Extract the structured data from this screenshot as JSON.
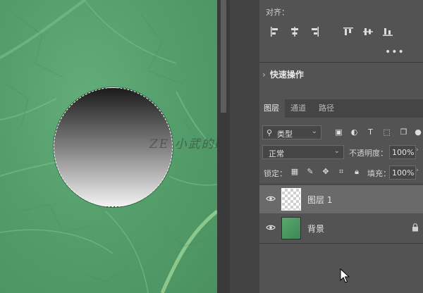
{
  "canvas": {
    "watermark": "ZE 小武的PS笔记"
  },
  "align_panel": {
    "title": "对齐：",
    "icons": [
      "align-left-edges-icon",
      "align-horizontal-centers-icon",
      "align-right-edges-icon",
      "align-top-edges-icon",
      "align-vertical-centers-icon",
      "align-bottom-edges-icon"
    ],
    "more": "•••"
  },
  "quick_actions": {
    "label": "快速操作"
  },
  "layers_panel": {
    "tabs": [
      "图层",
      "通道",
      "路径"
    ],
    "active_tab": "图层",
    "filter": {
      "label": "类型"
    },
    "blend_mode": "正常",
    "opacity_label": "不透明度：",
    "opacity_value": "100%",
    "lock_label": "锁定：",
    "fill_label": "填充：",
    "fill_value": "100%",
    "layers": [
      {
        "name": "图层 1",
        "selected": true,
        "visible": true,
        "locked": false
      },
      {
        "name": "背景",
        "selected": false,
        "visible": true,
        "locked": true
      }
    ]
  },
  "colors": {
    "panel_bg": "#535353",
    "selected_layer_bg": "#6a6a6a",
    "leaf_green": "#559f6c"
  }
}
